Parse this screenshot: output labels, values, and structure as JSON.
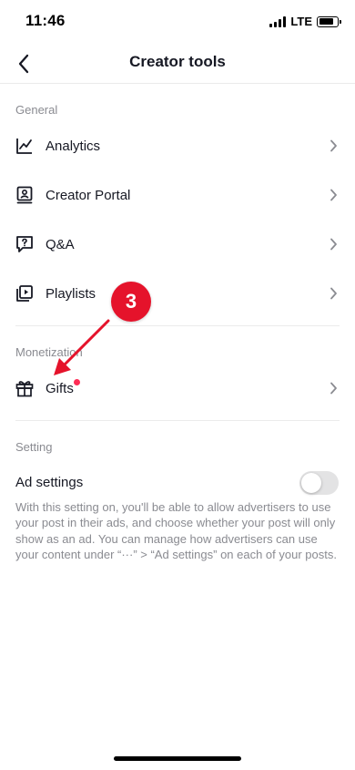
{
  "status_bar": {
    "time": "11:46",
    "network": "LTE"
  },
  "header": {
    "title": "Creator tools"
  },
  "general": {
    "header": "General",
    "items": [
      {
        "label": "Analytics",
        "icon": "analytics-chart-icon"
      },
      {
        "label": "Creator Portal",
        "icon": "creator-portal-icon"
      },
      {
        "label": "Q&A",
        "icon": "qa-icon"
      },
      {
        "label": "Playlists",
        "icon": "playlists-icon"
      }
    ]
  },
  "monetization": {
    "header": "Monetization",
    "items": [
      {
        "label": "Gifts",
        "icon": "gift-icon",
        "has_notification": true
      }
    ]
  },
  "setting": {
    "header": "Setting",
    "ad_settings": {
      "label": "Ad settings",
      "enabled": false,
      "description": "With this setting on, you'll be able to allow advertisers to use your post in their ads, and choose whether your post will only show as an ad. You can manage how advertisers can use your content under “···” > “Ad settings” on each of your posts."
    }
  },
  "annotation": {
    "step": "3"
  },
  "colors": {
    "accent": "#fe2c55",
    "annotation": "#e5132b",
    "text": "#161823",
    "muted": "#8a8b91"
  }
}
